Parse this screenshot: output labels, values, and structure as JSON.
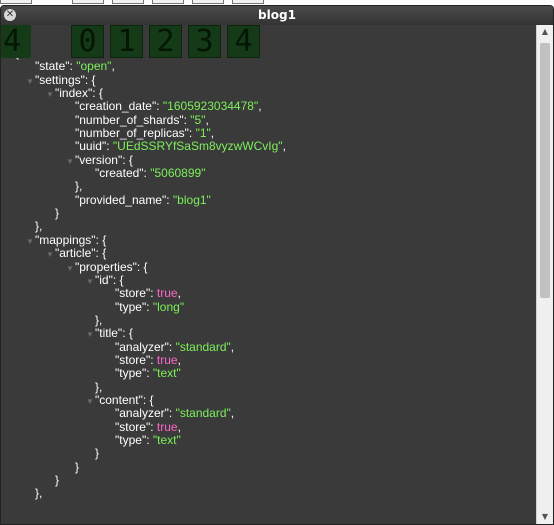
{
  "window": {
    "title": "blog1",
    "close_glyph": "✕"
  },
  "overlay": {
    "count": "4",
    "digits": [
      "0",
      "1",
      "2",
      "3",
      "4"
    ]
  },
  "json_lines": [
    {
      "indent": 0,
      "toggle": false,
      "parts": [
        [
          "p",
          "{"
        ]
      ]
    },
    {
      "indent": 1,
      "toggle": false,
      "parts": [
        [
          "k",
          "\"state\""
        ],
        [
          "p",
          ": "
        ],
        [
          "s",
          "\"open\""
        ],
        [
          "p",
          ","
        ]
      ]
    },
    {
      "indent": 1,
      "toggle": true,
      "parts": [
        [
          "k",
          "\"settings\""
        ],
        [
          "p",
          ": {"
        ]
      ]
    },
    {
      "indent": 2,
      "toggle": true,
      "parts": [
        [
          "k",
          "\"index\""
        ],
        [
          "p",
          ": {"
        ]
      ]
    },
    {
      "indent": 3,
      "toggle": false,
      "parts": [
        [
          "k",
          "\"creation_date\""
        ],
        [
          "p",
          ": "
        ],
        [
          "s",
          "\"1605923034478\""
        ],
        [
          "p",
          ","
        ]
      ]
    },
    {
      "indent": 3,
      "toggle": false,
      "parts": [
        [
          "k",
          "\"number_of_shards\""
        ],
        [
          "p",
          ": "
        ],
        [
          "s",
          "\"5\""
        ],
        [
          "p",
          ","
        ]
      ]
    },
    {
      "indent": 3,
      "toggle": false,
      "parts": [
        [
          "k",
          "\"number_of_replicas\""
        ],
        [
          "p",
          ": "
        ],
        [
          "s",
          "\"1\""
        ],
        [
          "p",
          ","
        ]
      ]
    },
    {
      "indent": 3,
      "toggle": false,
      "parts": [
        [
          "k",
          "\"uuid\""
        ],
        [
          "p",
          ": "
        ],
        [
          "s",
          "\"UEdSSRYfSaSm8vyzwWCvIg\""
        ],
        [
          "p",
          ","
        ]
      ]
    },
    {
      "indent": 3,
      "toggle": true,
      "parts": [
        [
          "k",
          "\"version\""
        ],
        [
          "p",
          ": {"
        ]
      ]
    },
    {
      "indent": 4,
      "toggle": false,
      "parts": [
        [
          "k",
          "\"created\""
        ],
        [
          "p",
          ": "
        ],
        [
          "s",
          "\"5060899\""
        ]
      ]
    },
    {
      "indent": 3,
      "toggle": false,
      "parts": [
        [
          "p",
          "},"
        ]
      ]
    },
    {
      "indent": 3,
      "toggle": false,
      "parts": [
        [
          "k",
          "\"provided_name\""
        ],
        [
          "p",
          ": "
        ],
        [
          "s",
          "\"blog1\""
        ]
      ]
    },
    {
      "indent": 2,
      "toggle": false,
      "parts": [
        [
          "p",
          "}"
        ]
      ]
    },
    {
      "indent": 1,
      "toggle": false,
      "parts": [
        [
          "p",
          "},"
        ]
      ]
    },
    {
      "indent": 1,
      "toggle": true,
      "parts": [
        [
          "k",
          "\"mappings\""
        ],
        [
          "p",
          ": {"
        ]
      ]
    },
    {
      "indent": 2,
      "toggle": true,
      "parts": [
        [
          "k",
          "\"article\""
        ],
        [
          "p",
          ": {"
        ]
      ]
    },
    {
      "indent": 3,
      "toggle": true,
      "parts": [
        [
          "k",
          "\"properties\""
        ],
        [
          "p",
          ": {"
        ]
      ]
    },
    {
      "indent": 4,
      "toggle": true,
      "parts": [
        [
          "k",
          "\"id\""
        ],
        [
          "p",
          ": {"
        ]
      ]
    },
    {
      "indent": 5,
      "toggle": false,
      "parts": [
        [
          "k",
          "\"store\""
        ],
        [
          "p",
          ": "
        ],
        [
          "b",
          "true"
        ],
        [
          "p",
          ","
        ]
      ]
    },
    {
      "indent": 5,
      "toggle": false,
      "parts": [
        [
          "k",
          "\"type\""
        ],
        [
          "p",
          ": "
        ],
        [
          "s",
          "\"long\""
        ]
      ]
    },
    {
      "indent": 4,
      "toggle": false,
      "parts": [
        [
          "p",
          "},"
        ]
      ]
    },
    {
      "indent": 4,
      "toggle": true,
      "parts": [
        [
          "k",
          "\"title\""
        ],
        [
          "p",
          ": {"
        ]
      ]
    },
    {
      "indent": 5,
      "toggle": false,
      "parts": [
        [
          "k",
          "\"analyzer\""
        ],
        [
          "p",
          ": "
        ],
        [
          "s",
          "\"standard\""
        ],
        [
          "p",
          ","
        ]
      ]
    },
    {
      "indent": 5,
      "toggle": false,
      "parts": [
        [
          "k",
          "\"store\""
        ],
        [
          "p",
          ": "
        ],
        [
          "b",
          "true"
        ],
        [
          "p",
          ","
        ]
      ]
    },
    {
      "indent": 5,
      "toggle": false,
      "parts": [
        [
          "k",
          "\"type\""
        ],
        [
          "p",
          ": "
        ],
        [
          "s",
          "\"text\""
        ]
      ]
    },
    {
      "indent": 4,
      "toggle": false,
      "parts": [
        [
          "p",
          "},"
        ]
      ]
    },
    {
      "indent": 4,
      "toggle": true,
      "parts": [
        [
          "k",
          "\"content\""
        ],
        [
          "p",
          ": {"
        ]
      ]
    },
    {
      "indent": 5,
      "toggle": false,
      "parts": [
        [
          "k",
          "\"analyzer\""
        ],
        [
          "p",
          ": "
        ],
        [
          "s",
          "\"standard\""
        ],
        [
          "p",
          ","
        ]
      ]
    },
    {
      "indent": 5,
      "toggle": false,
      "parts": [
        [
          "k",
          "\"store\""
        ],
        [
          "p",
          ": "
        ],
        [
          "b",
          "true"
        ],
        [
          "p",
          ","
        ]
      ]
    },
    {
      "indent": 5,
      "toggle": false,
      "parts": [
        [
          "k",
          "\"type\""
        ],
        [
          "p",
          ": "
        ],
        [
          "s",
          "\"text\""
        ]
      ]
    },
    {
      "indent": 4,
      "toggle": false,
      "parts": [
        [
          "p",
          "}"
        ]
      ]
    },
    {
      "indent": 3,
      "toggle": false,
      "parts": [
        [
          "p",
          "}"
        ]
      ]
    },
    {
      "indent": 2,
      "toggle": false,
      "parts": [
        [
          "p",
          "}"
        ]
      ]
    },
    {
      "indent": 1,
      "toggle": false,
      "parts": [
        [
          "p",
          "},"
        ]
      ]
    }
  ],
  "colors": {
    "string": "#7cf05a",
    "boolean": "#ff66cc",
    "key": "#ffffff",
    "background": "#3a3a3a"
  },
  "scrollbar": {
    "up_glyph": "▲",
    "down_glyph": "▼",
    "visible_fraction": 0.55
  }
}
